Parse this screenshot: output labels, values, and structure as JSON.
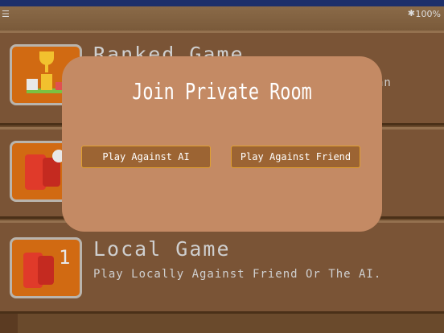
{
  "status_bar": {
    "left": "☰",
    "battery": "100%"
  },
  "cards": [
    {
      "title": "Ranked Game",
      "subtitle": "an"
    },
    {
      "title": "",
      "subtitle": ""
    },
    {
      "title": "Local Game",
      "subtitle": "Play Locally Against Friend Or The AI.",
      "badge": "1"
    }
  ],
  "modal": {
    "title": "Join Private Room",
    "button_ai": "Play Against AI",
    "button_friend": "Play Against Friend"
  },
  "colors": {
    "modal_bg": "#c48a64",
    "button_bg": "#9c6433",
    "button_border": "#e0a030",
    "icon_bg": "#d16a12"
  }
}
